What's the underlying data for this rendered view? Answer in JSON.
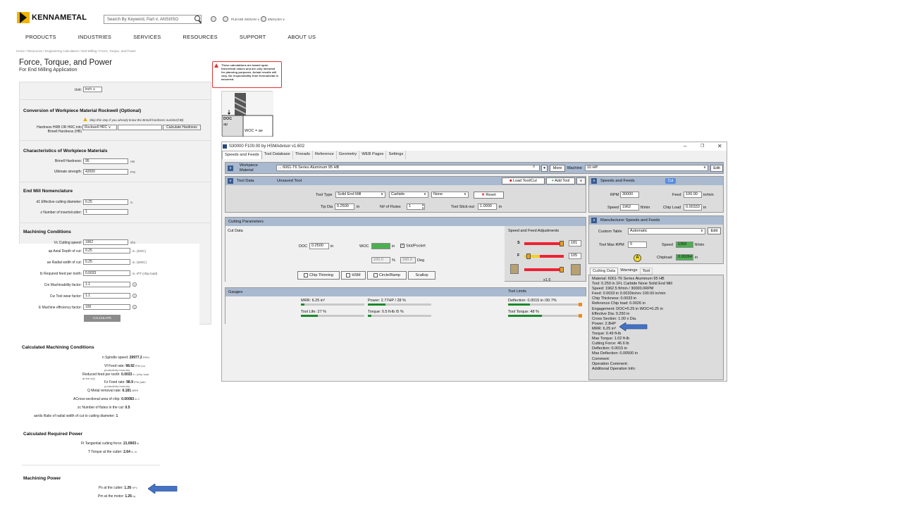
{
  "header": {
    "logo_text": "KENNAMETAL",
    "search_placeholder": "Search By Keyword, Part #, ANSI/ISO",
    "sign_in": "PLEASE SIGN-IN ∨",
    "language": "ENGLISH ∨",
    "nav": [
      "PRODUCTS",
      "INDUSTRIES",
      "SERVICES",
      "RESOURCES",
      "SUPPORT",
      "ABOUT US"
    ]
  },
  "breadcrumb": "Home  /  Resources  /  Engineering Calculators  /  End Milling  /  Force, Torque, and Power",
  "page": {
    "title": "Force, Torque, and Power",
    "subtitle": "For End Milling Application"
  },
  "form": {
    "unit_label": "Unit:",
    "unit_value": "inch",
    "conversion_title": "Conversion of Workpiece Material Rockwell (Optional)",
    "skip_note": "Skip this step if you already know the Brinell hardness number(HB)",
    "hardness_label_1": "Hardness HRB OR HRC into",
    "hardness_label_2": "Brinell Hardness (HB)",
    "hardness_select": "Rockwell HRC",
    "calc_hardness_btn": "Calculate Hardness",
    "characteristics_title": "Characteristics of Workpiece Materials",
    "brinell_label": "Brinell Hardness:",
    "brinell_value": "95",
    "brinell_unit": "HB",
    "ultimate_label": "Ultimate strength:",
    "ultimate_value": "42000",
    "ultimate_unit": "PSI",
    "nomenclature_title": "End Mill Nomenclature",
    "d1_label": "d1 Effective cutting diameter:",
    "d1_value": "0.25",
    "d1_unit": "in",
    "z_label": "z Number of inserts/cutter:",
    "z_value": "1",
    "machining_title": "Machining Conditions",
    "vc_label": "Vc Cutting speed:",
    "vc_value": "1962",
    "vc_unit": "sfm",
    "ap_label": "ap Axial Depth of cut:",
    "ap_value": "0.25",
    "ap_unit": "in. (DOC)",
    "ae_label": "ae Radial width of cut:",
    "ae_value": "0.25",
    "ae_unit": "in. (WOC)",
    "fz_label": "fz Required feed per tooth:",
    "fz_value": "0.0033",
    "fz_unit": "in. IPT (chip load)",
    "cm_label": "Cm Machinability factor:",
    "cm_value": "1.1",
    "cw_label": "Cw Tool wear factor:",
    "cw_value": "1.1",
    "e_label": "E Machine efficiency factor:",
    "e_value": "100",
    "calculate_btn": "CALCULATE",
    "q_icon": "?"
  },
  "results": {
    "conditions_title": "Calculated Machining Conditions",
    "rows": [
      {
        "label": "n Spindle speed:",
        "value": "29977.2",
        "unit": "RPM"
      },
      {
        "label": "Vf Feed rate:",
        "value": "98.92",
        "unit": "IPM (no productivity formula)"
      },
      {
        "label": "Reduced feed per tooth:",
        "value": "0.0033",
        "unit": "in. (chip load at the cut)"
      },
      {
        "label": "Fz Feed rate:",
        "value": "98.9",
        "unit": "IPM (with productivity formula)"
      },
      {
        "label": "Q Metal removal rate:",
        "value": "6.181",
        "unit": "MRR"
      },
      {
        "label": "ACross-sectional area of chip:",
        "value": "0.00083",
        "unit": "in.2"
      },
      {
        "label": "zc Number of flutes in the cut:",
        "value": "0.5",
        "unit": ""
      },
      {
        "label": "ae/ds Ratio of radial width of cut to cutting diameter:",
        "value": "1",
        "unit": ""
      }
    ],
    "power_title": "Calculated Required Power",
    "power_rows": [
      {
        "label": "Ft Tangential cutting force:",
        "value": "21.0903",
        "unit": "lb"
      },
      {
        "label": "T Torque at the cutter:",
        "value": "2.64",
        "unit": "in. lb"
      }
    ],
    "machining_power_title": "Machining Power",
    "mp_rows": [
      {
        "label": "Ps at the cutter:",
        "value": "1.26",
        "unit": "HPc"
      },
      {
        "label": "Pm at the motor:",
        "value": "1.26",
        "unit": "hp"
      }
    ]
  },
  "warning": "These calculations are based upon theoretical values and are only intended for planning purposes. Actual results will vary. No responsibility from Kennametal is assumed.",
  "diagram": {
    "doc": "DOC",
    "ap": "ap",
    "woc": "WOC = ae"
  },
  "hsm": {
    "title": "S30000 F100.00 by HSMAdvisor v1.602",
    "tabs": [
      "Speeds and Feeds",
      "Tool Database",
      "Threads",
      "Reference",
      "Geometry",
      "WEB Pages",
      "Settings"
    ],
    "workpiece_label_1": "Workpiece",
    "workpiece_label_2": "Material",
    "workpiece_value": "... 6061-T6 Series Aluminum 95 HB",
    "more_btn": "More",
    "machine_label": "Machine",
    "machine_value": "10 HP",
    "edit_btn": "Edit",
    "tool_data": "Tool Data",
    "unsaved_tool": "Unsaved Tool",
    "load_tool_btn": "Load Tool/Cut",
    "add_tool_btn": "Add Tool",
    "tool_type_label": "Tool Type",
    "tool_type_value": "Solid End Mill",
    "material_value": "Carbide",
    "coating_value": "None",
    "reset_btn": "Reset",
    "tip_dia_label": "Tip Dia",
    "tip_dia_value": "0.2500",
    "in": "in",
    "flutes_label": "N# of Flutes",
    "flutes_value": "1",
    "stickout_label": "Tool Stick-out",
    "stickout_value": "1.0000",
    "cutting_params": "Cutting Parameters",
    "cut_data": "Cut Data",
    "doc_label": "DOC",
    "doc_value": "0.2500",
    "woc_label": "WOC",
    "slot_label": "Slot/Pocket",
    "pct_value": "100.0",
    "pct": "%",
    "deg_value": "180.0",
    "deg": "Deg",
    "chip_thinning": "Chip Thinning",
    "hsm_chk": "HSM",
    "circle_ramp": "Circle/Ramp",
    "scallop": "Scallop",
    "adjustments": "Speed and Feed Adjustments",
    "s_label": "S",
    "s_value": "181",
    "f_label": "F",
    "f_value": "105",
    "x_value": "x1.5",
    "speeds_feeds": "Speeds and Feeds",
    "cut_badge": "Cut",
    "rpm_label": "RPM",
    "rpm_value": "30000",
    "feed_label": "Feed",
    "feed_value": "100.00",
    "feed_unit": "in/min",
    "speed_label": "Speed",
    "speed_value": "1962",
    "speed_unit": "ft/min",
    "chipload_label": "Chip Load",
    "chipload_value": "0.00333",
    "mfr_title": "Manufacturer Speeds and Feeds",
    "custom_table": "Custom Table",
    "custom_value": "Automatic",
    "max_rpm_label": "Tool Max RPM",
    "max_rpm_value": "0",
    "mfr_speed_label": "Speed",
    "mfr_speed_value": "1359",
    "mfr_speed_unit": "ft/min",
    "a_badge": "A",
    "mfr_chip_label": "Chipload",
    "mfr_chip_value": "0.00264",
    "mfr_chip_unit": "in",
    "gauges": "Gauges",
    "tool_limits": "Tool Limits",
    "gauge_mrr": "MRR: 6.25 in³",
    "gauge_power": "Power: 2.77HP / 28 %",
    "gauge_life": "Tool Life: 27 %",
    "gauge_torque": "Torque: 0.5 ft-lb /5 %",
    "gauge_deflection": "Deflection: 0.0015 in /30.7%",
    "gauge_tool_torque": "Tool Torque: 48 %",
    "gauge_levels": {
      "mrr": 0.05,
      "power": 0.28,
      "life": 0.27,
      "torque": 0.05,
      "deflection": 0.307,
      "tool_torque": 0.48
    },
    "bottom_tabs": [
      "Cutting Data",
      "Warnings",
      "Tool"
    ],
    "cutting_data_lines": [
      "Material: 6061-T6 Series Aluminum 95 HB",
      "Tool: 0.250 in 1FL Carbide None Solid End Mill",
      "Speed: 1962.5 ft/min / 30000.0RPM",
      "Feed: 0.0033 in 0.0033in/rev 100.00 in/min",
      "Chip Thickness: 0.0033 in",
      "Reference Chip load: 0.0026 in",
      "Engagement: DOC=0.25 in WOC=0.25 in",
      "Effective Dia: 0.250 in",
      "Cross Section: 1.00 x Dia.",
      "Power: 2.8HP",
      "MRR: 6.25 in³",
      "Torque: 0.49 ft-lb",
      "Max Torque: 1.02 ft-lb",
      "Cutting Force: 46.6 lb",
      "Deflection: 0.0015 in",
      "Max Deflection: 0.00500 in",
      "Comment:",
      "Operation Comment:",
      "Additional Operation Info:"
    ]
  },
  "colors": {
    "accent_blue": "#4472c4",
    "panel_header": "#a9b9cf",
    "gauge_green": "#1a8a2a",
    "warning_red": "#dd3333",
    "logo_yellow": "#f2b400"
  }
}
